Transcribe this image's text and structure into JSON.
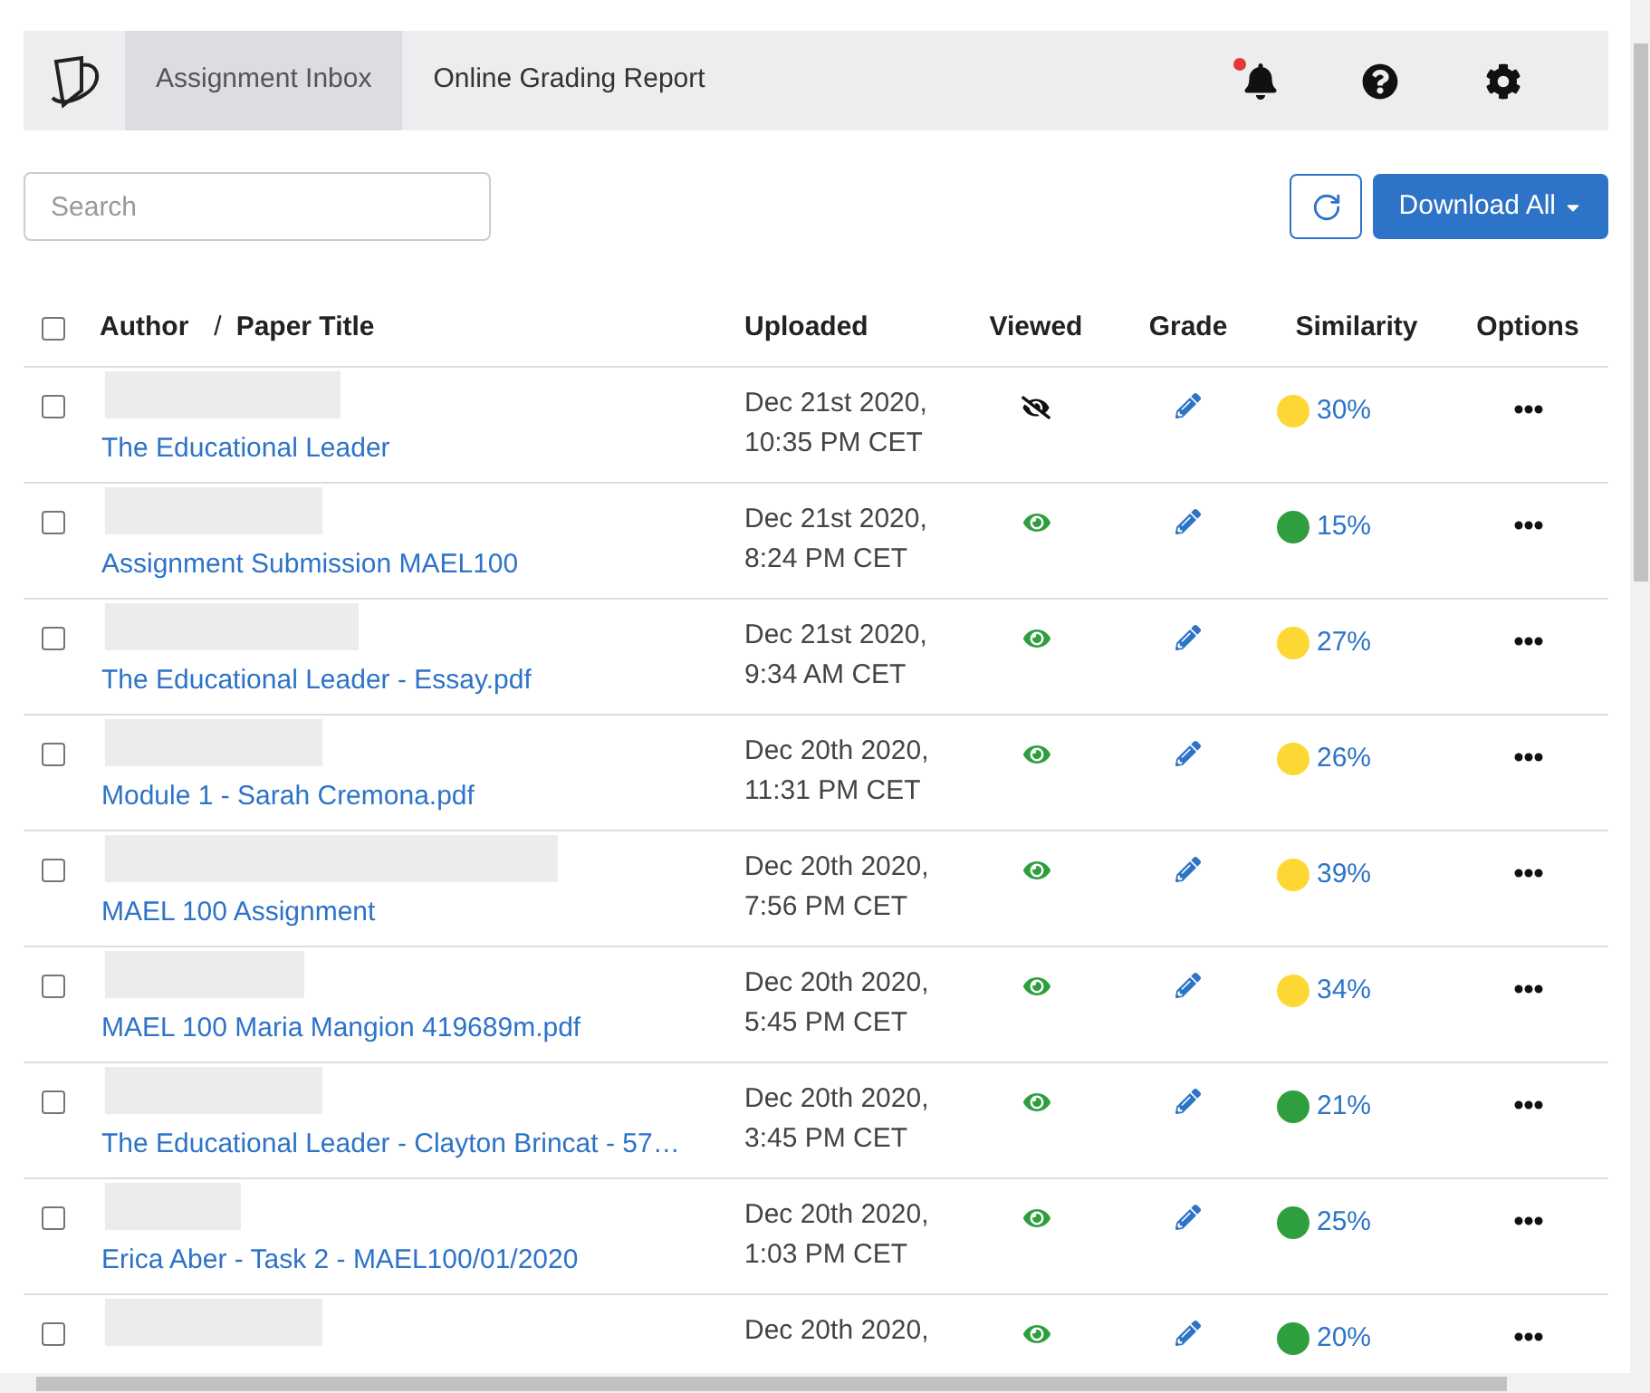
{
  "nav": {
    "tabs": [
      {
        "label": "Assignment Inbox",
        "selected": true
      },
      {
        "label": "Online Grading Report",
        "selected": false
      }
    ],
    "notification_unread": true
  },
  "search": {
    "placeholder": "Search"
  },
  "download_button": {
    "label": "Download All"
  },
  "table": {
    "header_checked": false,
    "columns": [
      {
        "label": "Author"
      },
      {
        "label": "/"
      },
      {
        "label": "Paper Title"
      },
      {
        "label": "Uploaded"
      },
      {
        "label": "Viewed"
      },
      {
        "label": "Grade"
      },
      {
        "label": "Similarity"
      },
      {
        "label": "Options"
      }
    ],
    "rows": [
      {
        "checked": false,
        "title": "The Educational Leader",
        "date": "Dec 21st 2020,",
        "time": "10:35 PM CET",
        "viewed": false,
        "similarity": "30%",
        "color": "#fdd835"
      },
      {
        "checked": false,
        "title": "Assignment Submission MAEL100",
        "date": "Dec 21st 2020,",
        "time": "8:24 PM CET",
        "viewed": true,
        "similarity": "15%",
        "color": "#2e9e3e"
      },
      {
        "checked": false,
        "title": "The Educational Leader - Essay.pdf",
        "date": "Dec 21st 2020,",
        "time": "9:34 AM CET",
        "viewed": true,
        "similarity": "27%",
        "color": "#fdd835"
      },
      {
        "checked": false,
        "title": "Module 1 - Sarah Cremona.pdf",
        "date": "Dec 20th 2020,",
        "time": "11:31 PM CET",
        "viewed": true,
        "similarity": "26%",
        "color": "#fdd835"
      },
      {
        "checked": false,
        "title": "MAEL 100 Assignment",
        "date": "Dec 20th 2020,",
        "time": "7:56 PM CET",
        "viewed": true,
        "similarity": "39%",
        "color": "#fdd835"
      },
      {
        "checked": false,
        "title": "MAEL 100 Maria Mangion 419689m.pdf",
        "date": "Dec 20th 2020,",
        "time": "5:45 PM CET",
        "viewed": true,
        "similarity": "34%",
        "color": "#fdd835"
      },
      {
        "checked": false,
        "title": "The Educational Leader - Clayton Brincat - 57…",
        "date": "Dec 20th 2020,",
        "time": "3:45 PM CET",
        "viewed": true,
        "similarity": "21%",
        "color": "#2e9e3e"
      },
      {
        "checked": false,
        "title": "Erica Aber - Task 2 - MAEL100/01/2020",
        "date": "Dec 20th 2020,",
        "time": "1:03 PM CET",
        "viewed": true,
        "similarity": "25%",
        "color": "#2e9e3e"
      },
      {
        "checked": false,
        "date": "Dec 20th 2020,",
        "viewed": true,
        "similarity": "20%",
        "color": "#2e9e3e"
      }
    ]
  }
}
